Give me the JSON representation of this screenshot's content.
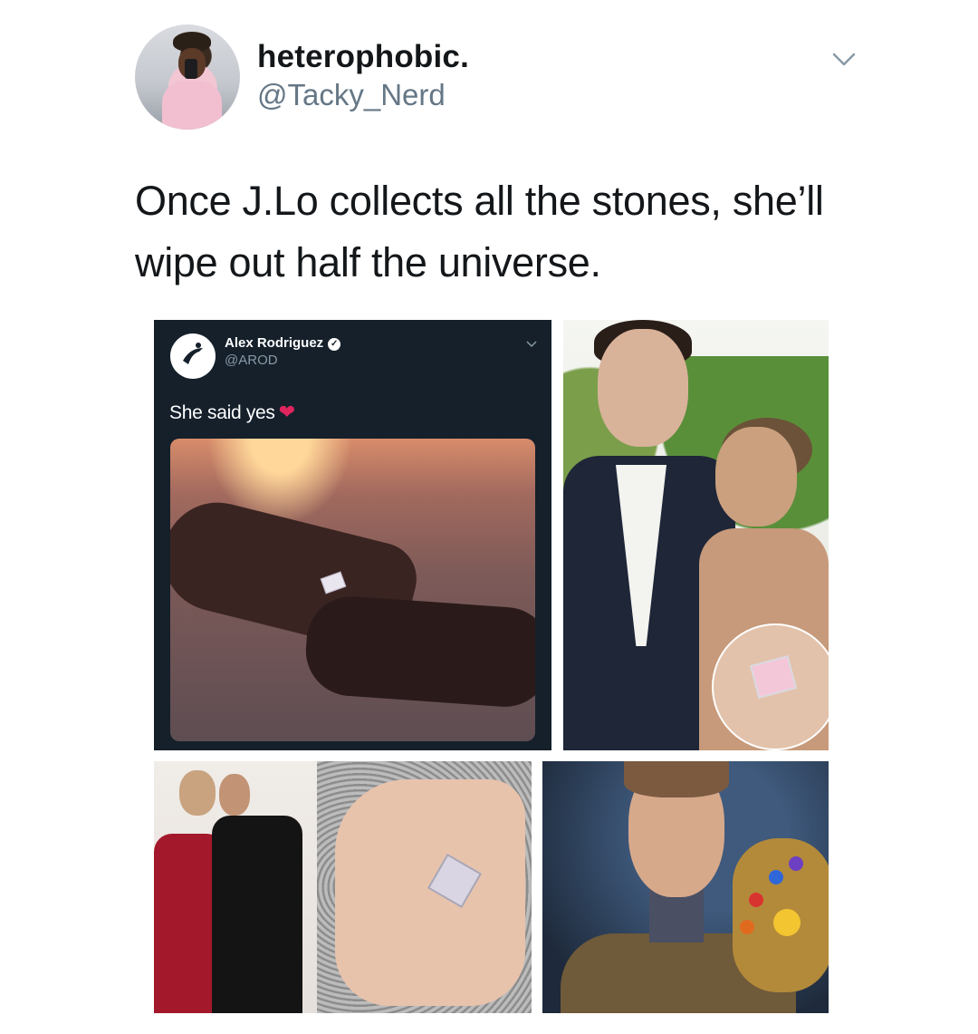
{
  "tweet": {
    "display_name": "heterophobic.",
    "handle": "@Tacky_Nerd",
    "text": "Once J.Lo collects all the stones, she’ll wipe out half the universe."
  },
  "embedded_tweet": {
    "display_name": "Alex Rodriguez",
    "handle": "@AROD",
    "text": "She said yes"
  },
  "icons": {
    "more": "chevron-down-icon",
    "verified": "verified-badge-icon",
    "heart": "red-heart-icon"
  },
  "colors": {
    "handle_gray": "#657786",
    "dark_card": "#15202b",
    "heart_red": "#e0245e"
  }
}
